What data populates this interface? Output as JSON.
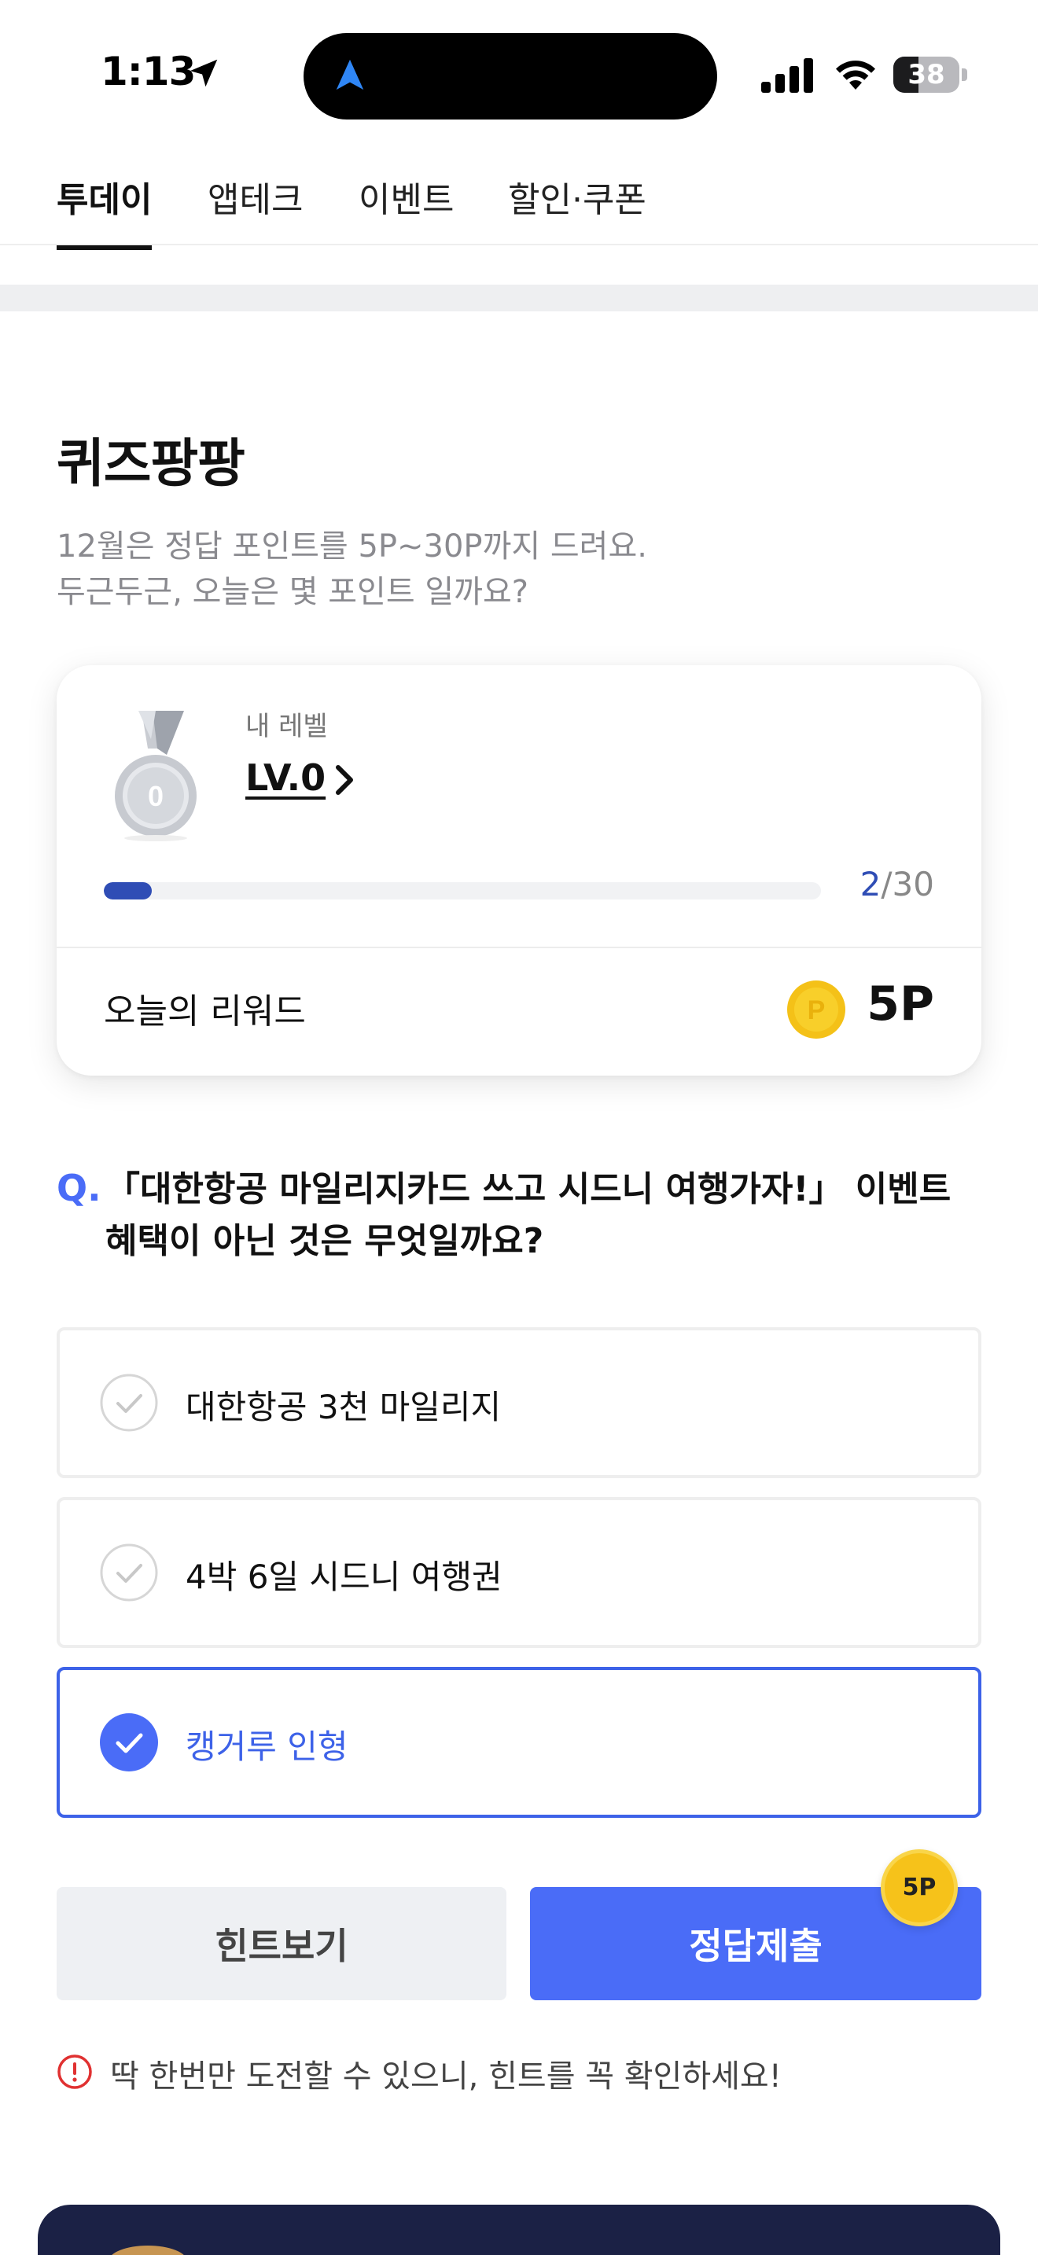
{
  "status_bar": {
    "time": "1:13",
    "battery": "38",
    "battery_level": 0.38
  },
  "tabs": [
    {
      "label": "투데이",
      "active": true
    },
    {
      "label": "앱테크",
      "active": false
    },
    {
      "label": "이벤트",
      "active": false
    },
    {
      "label": "할인·쿠폰",
      "active": false
    }
  ],
  "quiz": {
    "title": "퀴즈팡팡",
    "desc_line1": "12월은 정답 포인트를 5P~30P까지 드려요.",
    "desc_line2": "두근두근, 오늘은 몇 포인트 일까요?"
  },
  "level_card": {
    "medal_number": "0",
    "label": "내 레벨",
    "level": "LV.0",
    "progress_current": "2",
    "progress_total": "/30",
    "progress_fraction": 0.0667,
    "reward_label": "오늘의 리워드",
    "coin_symbol": "P",
    "reward_value": "5P"
  },
  "question": {
    "mark": "Q.",
    "line1": "「대한항공 마일리지카드 쓰고 시드니 여행가자!」 이벤트",
    "line2": "혜택이 아닌 것은 무엇일까요?"
  },
  "options": [
    {
      "label": "대한항공 3천 마일리지",
      "selected": false
    },
    {
      "label": "4박 6일 시드니 여행권",
      "selected": false
    },
    {
      "label": "캥거루 인형",
      "selected": true
    }
  ],
  "buttons": {
    "hint": "힌트보기",
    "submit": "정답제출",
    "submit_badge": "5P"
  },
  "warning": "딱 한번만 도전할 수 있으니, 힌트를 꼭 확인하세요!",
  "colors": {
    "accent": "#4a6cf7",
    "progress": "#2f4db5",
    "coin": "#f6c21a",
    "warning": "#e03131"
  }
}
